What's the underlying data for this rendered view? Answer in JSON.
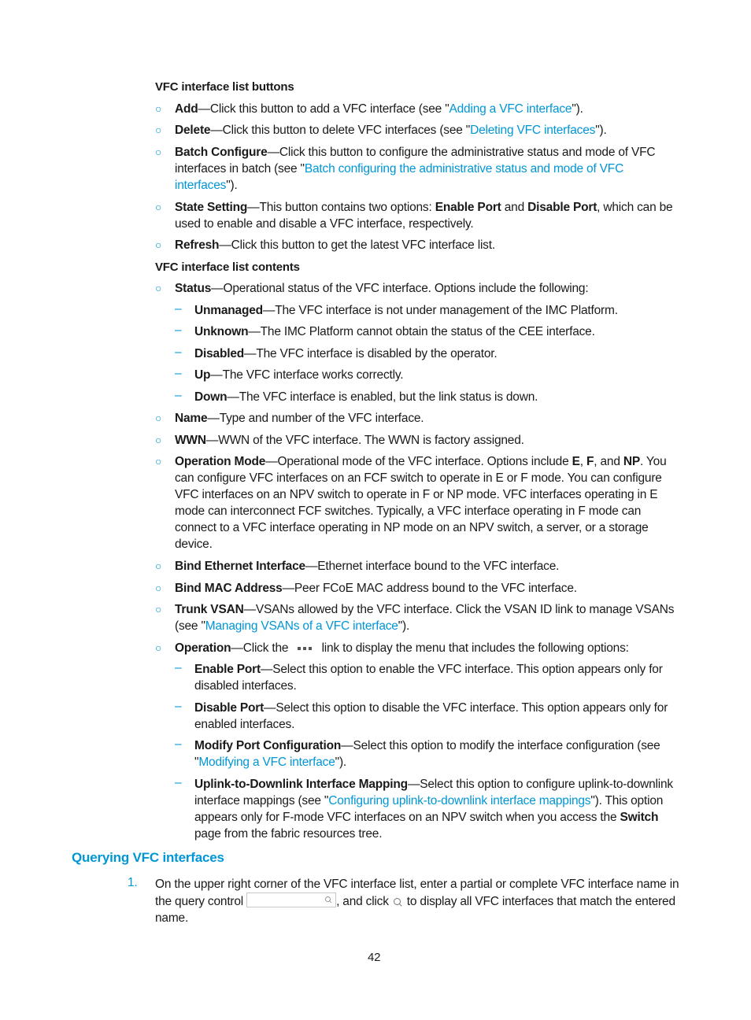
{
  "buttons_section": {
    "heading": "VFC interface list buttons",
    "items": [
      {
        "term": "Add",
        "text_before": "—Click this button to add a VFC interface (see \"",
        "link": "Adding a VFC interface",
        "text_after": "\")."
      },
      {
        "term": "Delete",
        "text_before": "—Click this button to delete VFC interfaces (see \"",
        "link": "Deleting VFC interfaces",
        "text_after": "\")."
      },
      {
        "term": "Batch Configure",
        "text_before": "—Click this button to configure the administrative status and mode of VFC interfaces in batch (see \"",
        "link": "Batch configuring the administrative status and mode of VFC interfaces",
        "text_after": "\")."
      },
      {
        "term": "State Setting",
        "text_before": "—This button contains two options: ",
        "opt1": "Enable Port",
        "mid": " and ",
        "opt2": "Disable Port",
        "text_after": ", which can be used to enable and disable a VFC interface, respectively."
      },
      {
        "term": "Refresh",
        "text_before": "—Click this button to get the latest VFC interface list."
      }
    ]
  },
  "contents_section": {
    "heading": "VFC interface list contents",
    "status": {
      "term": "Status",
      "text": "—Operational status of the VFC interface. Options include the following:",
      "sub": [
        {
          "term": "Unmanaged",
          "text": "—The VFC interface is not under management of the IMC Platform."
        },
        {
          "term": "Unknown",
          "text": "—The IMC Platform cannot obtain the status of the CEE interface."
        },
        {
          "term": "Disabled",
          "text": "—The VFC interface is disabled by the operator."
        },
        {
          "term": "Up",
          "text": "—The VFC interface works correctly."
        },
        {
          "term": "Down",
          "text": "—The VFC interface is enabled, but the link status is down."
        }
      ]
    },
    "name": {
      "term": "Name",
      "text": "—Type and number of the VFC interface."
    },
    "wwn": {
      "term": "WWN",
      "text": "—WWN of the VFC interface. The WWN is factory assigned."
    },
    "operation_mode": {
      "term": "Operation Mode",
      "t1": "—Operational mode of the VFC interface. Options include ",
      "e": "E",
      "c1": ", ",
      "f": "F",
      "c2": ", and ",
      "np": "NP",
      "t2": ". You can configure VFC interfaces on an FCF switch to operate in E or F mode. You can configure VFC interfaces on an NPV switch to operate in F or NP mode. VFC interfaces operating in E mode can interconnect FCF switches. Typically, a VFC interface operating in F mode can connect to a VFC interface operating in NP mode on an NPV switch, a server, or a storage device."
    },
    "bind_eth": {
      "term": "Bind Ethernet Interface",
      "text": "—Ethernet interface bound to the VFC interface."
    },
    "bind_mac": {
      "term": "Bind MAC Address",
      "text": "—Peer FCoE MAC address bound to the VFC interface."
    },
    "trunk_vsan": {
      "term": "Trunk VSAN",
      "text_before": "—VSANs allowed by the VFC interface. Click the VSAN ID link to manage VSANs (see \"",
      "link": "Managing VSANs of a VFC interface",
      "text_after": "\")."
    },
    "operation": {
      "term": "Operation",
      "t1": "—Click the",
      "t2": "link to display the menu that includes the following options:",
      "icon": "more-dots-icon",
      "sub": [
        {
          "term": "Enable Port",
          "text": "—Select this option to enable the VFC interface. This option appears only for disabled interfaces."
        },
        {
          "term": "Disable Port",
          "text": "—Select this option to disable the VFC interface. This option appears only for enabled interfaces."
        },
        {
          "term": "Modify Port Configuration",
          "text_before": "—Select this option to modify the interface configuration (see \"",
          "link": "Modifying a VFC interface",
          "text_after": "\")."
        },
        {
          "term": "Uplink-to-Downlink Interface Mapping",
          "text_before": "—Select this option to configure uplink-to-downlink interface mappings (see \"",
          "link": "Configuring uplink-to-downlink interface mappings",
          "text_mid": "\"). This option appears only for F-mode VFC interfaces on an NPV switch when you access the ",
          "bold": "Switch",
          "text_after": " page from the fabric resources tree."
        }
      ]
    }
  },
  "query_section": {
    "title": "Querying VFC interfaces",
    "steps": [
      {
        "num": "1.",
        "t1": "On the upper right corner of the VFC interface list, enter a partial or complete VFC interface name in the query control",
        "t2": ", and click",
        "t3": "to display all VFC interfaces that match the entered name.",
        "query_placeholder": "",
        "icon": "search-icon"
      }
    ]
  },
  "footer": {
    "page_number": "42"
  }
}
